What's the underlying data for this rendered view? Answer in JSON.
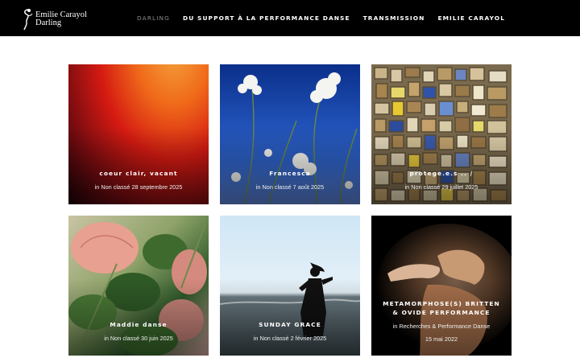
{
  "header": {
    "logo": {
      "line1": "Emilie Carayol",
      "line2": "Darling"
    },
    "nav": [
      {
        "label": "DARLING",
        "active": true
      },
      {
        "label": "DU SUPPORT À LA PERFORMANCE DANSE",
        "active": false
      },
      {
        "label": "TRANSMISSION",
        "active": false
      },
      {
        "label": "EMILIE CARAYOL",
        "active": false
      }
    ]
  },
  "posts": [
    {
      "title": "coeur clair, vacant",
      "meta": "in Non classé  28 septembre 2025"
    },
    {
      "title": "Francesca",
      "meta": "in Non classé  7 août 2025"
    },
    {
      "title": "protege.e.s .. /",
      "meta": "in Non classé  29 juillet 2025"
    },
    {
      "title": "Maddie danse",
      "meta": "in Non classé  30 juin 2025"
    },
    {
      "title": "SUNDAY GRACE",
      "meta": "in Non classé  2 février 2025"
    },
    {
      "title": "METAMORPHOSE(S) BRITTEN & OVIDE PERFORMANCE",
      "meta": "in Recherches & Performance Danse",
      "date": "15 mai 2022"
    }
  ],
  "colors": {
    "header_bg": "#000000",
    "nav_active": "#8a8a8a",
    "page_bg": "#ffffff"
  }
}
